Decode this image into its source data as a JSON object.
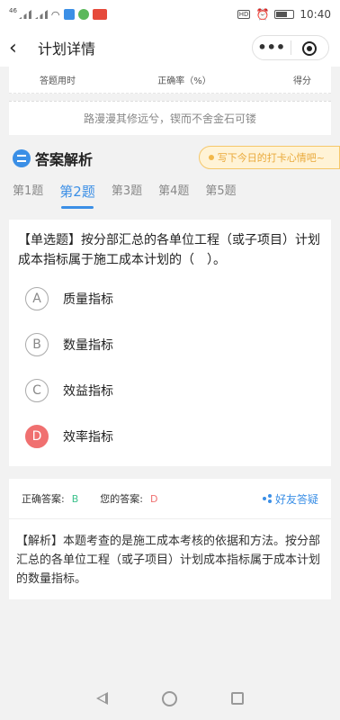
{
  "status_bar": {
    "signal_label": "46",
    "time": "10:40",
    "hd": "HD"
  },
  "header": {
    "back_icon": "chevron-left",
    "title": "计划详情",
    "more_icon": "•••",
    "target_icon": "target"
  },
  "stats": {
    "time_label": "答题用时",
    "accuracy_label": "正确率（%）",
    "score_label": "得分"
  },
  "quote": "路漫漫其修远兮，锲而不舍金石可镂",
  "analysis": {
    "title": "答案解析",
    "mood_button": "写下今日的打卡心情吧~"
  },
  "tabs": [
    {
      "label": "第1题",
      "active": false
    },
    {
      "label": "第2题",
      "active": true
    },
    {
      "label": "第3题",
      "active": false
    },
    {
      "label": "第4题",
      "active": false
    },
    {
      "label": "第5题",
      "active": false
    }
  ],
  "question": {
    "text": "【单选题】按分部汇总的各单位工程（或子项目）计划成本指标属于施工成本计划的（　）。",
    "options": [
      {
        "letter": "A",
        "label": "质量指标"
      },
      {
        "letter": "B",
        "label": "数量指标"
      },
      {
        "letter": "C",
        "label": "效益指标"
      },
      {
        "letter": "D",
        "label": "效率指标"
      }
    ]
  },
  "answer": {
    "correct_label": "正确答案:",
    "correct_value": "B",
    "yours_label": "您的答案:",
    "yours_value": "D",
    "share_label": "好友答疑"
  },
  "explanation": "【解析】本题考查的是施工成本考核的依据和方法。按分部汇总的各单位工程（或子项目）计划成本指标属于成本计划的数量指标。",
  "colors": {
    "accent": "#3b8fe6",
    "correct": "#3cc28c",
    "wrong": "#f07070",
    "mood": "#e9a93a"
  }
}
